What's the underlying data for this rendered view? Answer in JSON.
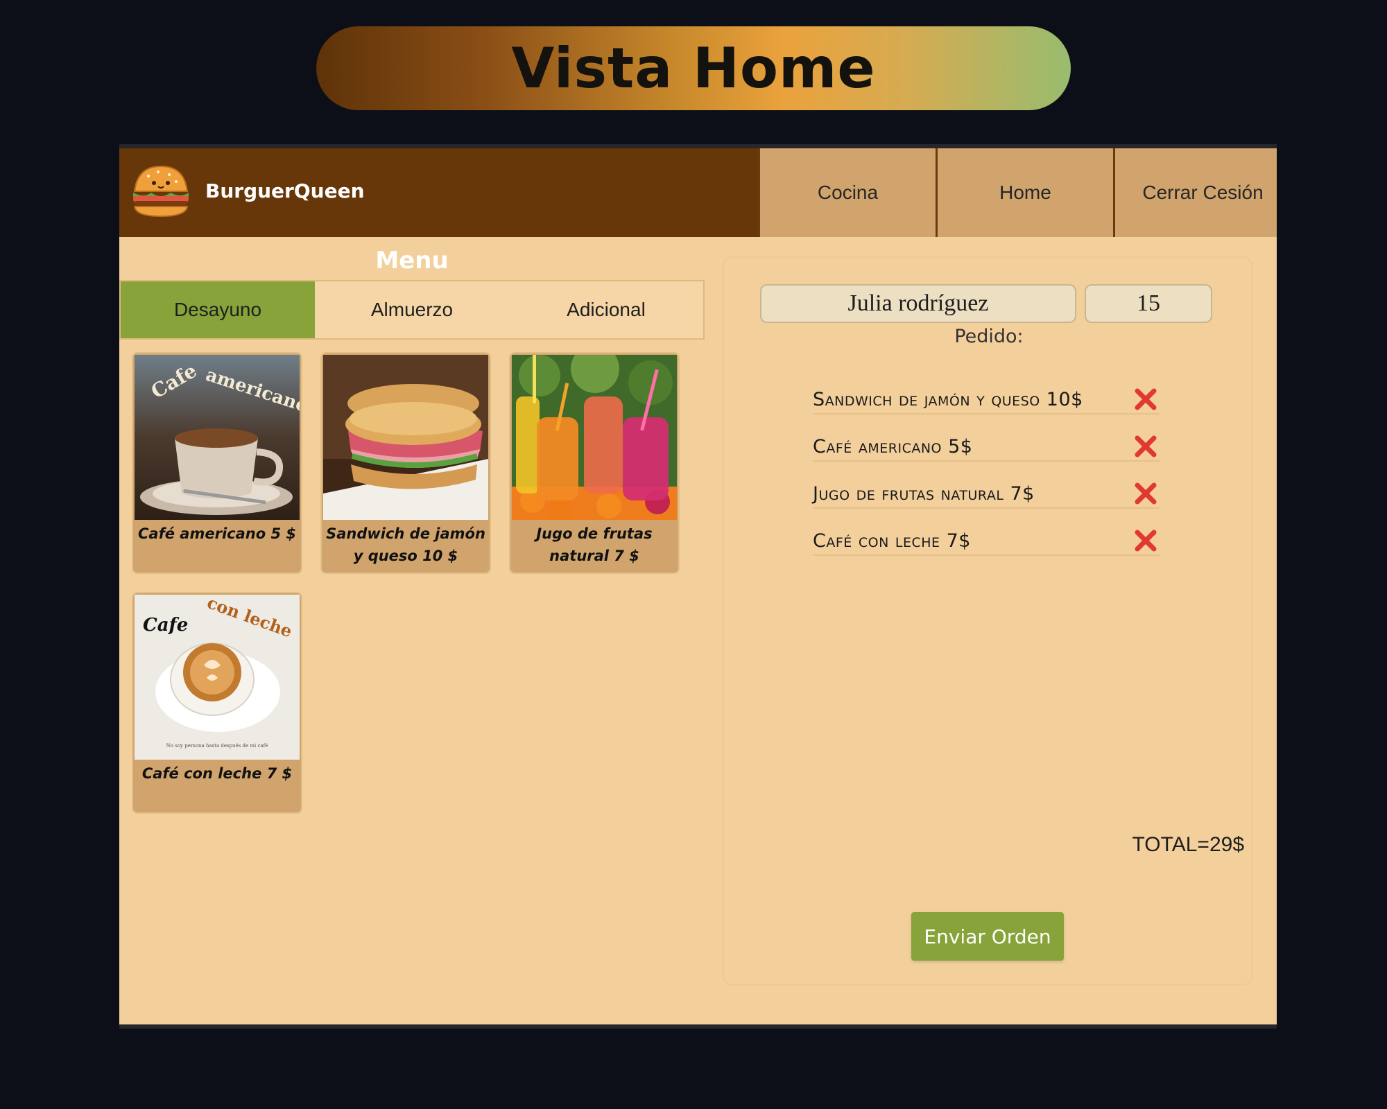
{
  "banner": {
    "title": "Vista Home"
  },
  "header": {
    "brand": "BurguerQueen",
    "nav": [
      "Cocina",
      "Home",
      "Cerrar Cesión"
    ]
  },
  "menu": {
    "title": "Menu",
    "tabs": [
      "Desayuno",
      "Almuerzo",
      "Adicional"
    ],
    "active_tab": "Desayuno",
    "products": [
      {
        "label": "Café americano 5 $",
        "image_text": [
          "Cafe",
          "americano"
        ]
      },
      {
        "label": "Sandwich de jamón y queso 10 $"
      },
      {
        "label": "Jugo de frutas natural 7 $"
      },
      {
        "label": "Café con leche 7 $",
        "image_text": [
          "Cafe",
          "con leche",
          "No soy persona hasta después de mi café"
        ]
      }
    ]
  },
  "order": {
    "client_name": "Julia rodríguez",
    "table_number": "15",
    "label": "Pedido:",
    "items": [
      "Sandwich de jamón y queso 10$",
      "Café americano 5$",
      "Jugo de frutas natural 7$",
      "Café con leche 7$"
    ],
    "total": "TOTAL=29$",
    "submit_label": "Enviar Orden"
  },
  "colors": {
    "header_bg": "#673609",
    "nav_bg": "#d0a46c",
    "app_bg": "#f3cf9c",
    "accent_green": "#88a339",
    "remove_red": "#e03a2f"
  }
}
